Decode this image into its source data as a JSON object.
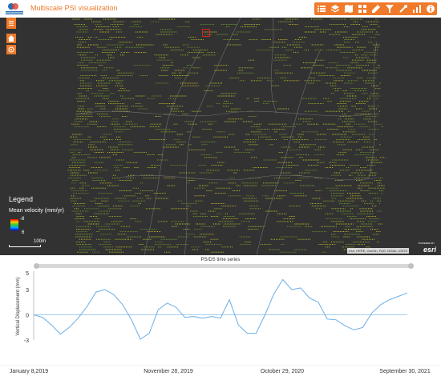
{
  "header": {
    "title": "Multiscale PSI visualization",
    "logo_text": "GEMB GEOLOGIC"
  },
  "toolbar": {
    "buttons": [
      {
        "name": "list-icon"
      },
      {
        "name": "layers-icon"
      },
      {
        "name": "map-icon"
      },
      {
        "name": "grid-icon"
      },
      {
        "name": "edit-icon"
      },
      {
        "name": "filter-icon"
      },
      {
        "name": "tools-icon"
      },
      {
        "name": "chart-icon"
      },
      {
        "name": "info-icon"
      }
    ],
    "accent": "#f07a2a"
  },
  "map_tools": [
    {
      "name": "menu-icon"
    },
    {
      "name": "home-icon"
    },
    {
      "name": "locate-icon"
    }
  ],
  "legend": {
    "title": "Legend",
    "subtitle": "Mean velocity (mm/yr)",
    "max_label": "-8",
    "min_label": "6"
  },
  "scalebar": {
    "label": "100m"
  },
  "attribution": {
    "text": "Esri, HERE, Garmin, FAO, NOAA, USGS",
    "powered": "POWERED BY",
    "logo": "esri"
  },
  "timeseries": {
    "title": "PS/DS time series",
    "ylabel": "Vertical Displacement (mm)",
    "xtick_labels": [
      "January 8,2019",
      "November 28, 2019",
      "October 29, 2020",
      "September 30, 2021"
    ],
    "ytick_labels": [
      "5",
      "3",
      "0",
      "-3"
    ]
  },
  "chart_data": {
    "type": "line",
    "title": "PS/DS time series",
    "xlabel": "",
    "ylabel": "Vertical Displacement (mm)",
    "ylim": [
      -3,
      5
    ],
    "x_ticks": [
      "January 8,2019",
      "November 28, 2019",
      "October 29, 2020",
      "September 30, 2021"
    ],
    "series": [
      {
        "color": "#6aaee6",
        "x": [
          "2019-01-08",
          "2019-02-01",
          "2019-02-25",
          "2019-03-21",
          "2019-04-14",
          "2019-05-08",
          "2019-06-01",
          "2019-06-25",
          "2019-07-19",
          "2019-08-12",
          "2019-09-05",
          "2019-09-29",
          "2019-10-23",
          "2019-11-16",
          "2019-12-10",
          "2020-01-03",
          "2020-01-27",
          "2020-02-20",
          "2020-03-15",
          "2020-04-08",
          "2020-05-02",
          "2020-05-26",
          "2020-06-19",
          "2020-07-13",
          "2020-08-06",
          "2020-08-30",
          "2020-09-23",
          "2020-10-17",
          "2020-11-10",
          "2020-12-04",
          "2020-12-28",
          "2021-01-21",
          "2021-02-14",
          "2021-03-10",
          "2021-04-03",
          "2021-04-27",
          "2021-05-21",
          "2021-06-14",
          "2021-07-08",
          "2021-08-01",
          "2021-08-25",
          "2021-09-18",
          "2021-10-12"
        ],
        "values": [
          0.0,
          -0.3,
          -1.2,
          -2.3,
          -1.5,
          -0.4,
          1.0,
          2.7,
          3.0,
          2.4,
          1.2,
          -0.6,
          -2.9,
          -2.2,
          0.6,
          1.4,
          0.9,
          -0.3,
          -0.2,
          -0.4,
          -0.2,
          -0.4,
          1.8,
          -1.2,
          -2.2,
          -2.2,
          0.0,
          2.5,
          4.2,
          3.0,
          3.2,
          2.0,
          1.5,
          -0.5,
          -0.6,
          -1.3,
          -1.8,
          -1.5,
          0.2,
          1.2,
          1.8,
          2.2,
          2.6
        ]
      }
    ]
  }
}
